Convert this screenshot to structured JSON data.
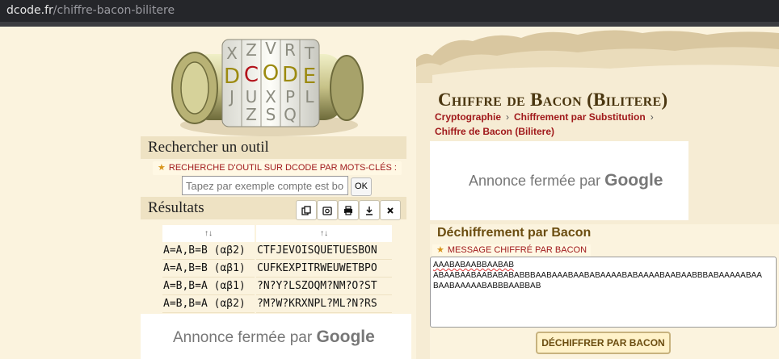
{
  "browser": {
    "url_host": "dcode.fr",
    "url_path": "/chiffre-bacon-bilitere"
  },
  "logo": {
    "letters": [
      "X",
      "Z",
      "V",
      "R",
      "T",
      "D",
      "C",
      "O",
      "D",
      "E",
      "J",
      "U",
      "X",
      "P",
      "L",
      "Z",
      "S",
      "Q"
    ]
  },
  "search": {
    "heading": "Rechercher un outil",
    "keyword_label": "RECHERCHE D'OUTIL SUR DCODE PAR MOTS-CLÉS :",
    "placeholder": "Tapez par exemple compte est bon",
    "ok_label": "OK"
  },
  "results": {
    "heading": "Résultats",
    "toolbar_icons": [
      "copy-icon",
      "screenshot-icon",
      "print-icon",
      "download-icon",
      "close-icon"
    ],
    "sort_label_1": "↑↓",
    "sort_label_2": "↑↓",
    "rows": [
      {
        "key": "A=A,B=B (αβ2)",
        "value": "CTFJEVOISQUETUESBON"
      },
      {
        "key": "A=A,B=B (αβ1)",
        "value": "CUFKEXPITRWEUWETBPO"
      },
      {
        "key": "A=B,B=A (αβ1)",
        "value": "?N?Y?LSZOQM?NM?O?ST"
      },
      {
        "key": "A=B,B=A (αβ2)",
        "value": "?M?W?KRXNPL?ML?N?RS"
      }
    ]
  },
  "ads": {
    "text": "Annonce fermée par",
    "brand": "Google"
  },
  "main": {
    "title": "Chiffre de Bacon (Bilitere)",
    "breadcrumb": [
      "Cryptographie",
      "Chiffrement par Substitution",
      "Chiffre de Bacon (Bilitere)"
    ],
    "breadcrumb_sep": "›",
    "decipher": {
      "title": "Déchiffrement par Bacon",
      "message_label": "MESSAGE CHIFFRÉ PAR BACON",
      "message_line1": "AAABABAABBAABAB",
      "message_line2": "ABAABAABAABABABABBBAABAAABAABABAAAABABAAAABAABAABBBABAAAAABAA",
      "message_line3": "BAABAAAAABABBBAABBAB",
      "button_label": "DÉCHIFFRER PAR BACON"
    }
  },
  "colors": {
    "accent_red": "#a0191b",
    "title_brown": "#4a3610",
    "star": "#d8941a"
  }
}
